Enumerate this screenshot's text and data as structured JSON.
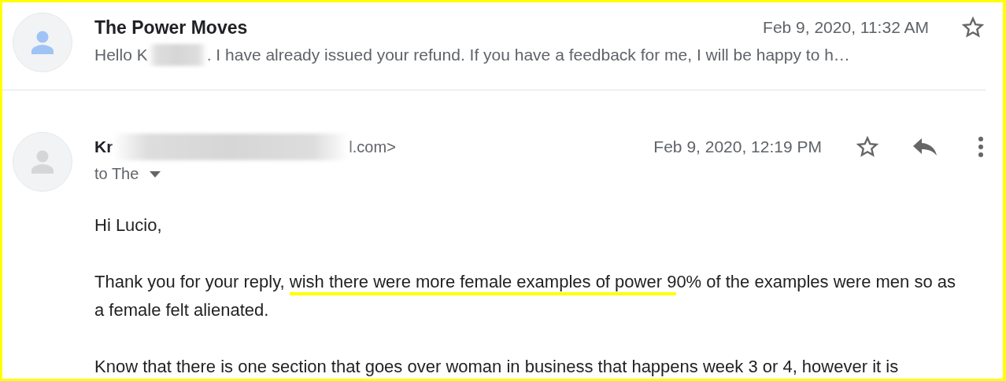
{
  "messages": [
    {
      "kind": "collapsed",
      "color": "#a0c3f5",
      "sender": "The Power Moves",
      "date": "Feb 9, 2020, 11:32 AM",
      "starred": false,
      "preview_start": "Hello K",
      "preview_end": ". I have already issued your refund. If you have a feedback for me, I will be happy to h…"
    },
    {
      "kind": "expanded",
      "color": "#d6d6d6",
      "sender_start": "Kr",
      "sender_end": "l.com>",
      "date": "Feb 9, 2020, 12:19 PM",
      "starred": false,
      "recipient": "to The",
      "body": [
        {
          "segments": [
            {
              "text": "Hi Lucio,",
              "underlined": false
            }
          ]
        },
        {
          "segments": [
            {
              "text": "Thank you for your reply, ",
              "underlined": false
            },
            {
              "text": "wish there were more female examples of power 9",
              "underlined": true
            },
            {
              "text": "0% of the examples were men so as a female felt alienated.",
              "underlined": false
            }
          ]
        },
        {
          "segments": [
            {
              "text": "Know that there is one section that goes over woman in business that happens week 3 or 4, however it is",
              "underlined": false
            }
          ]
        }
      ]
    }
  ]
}
